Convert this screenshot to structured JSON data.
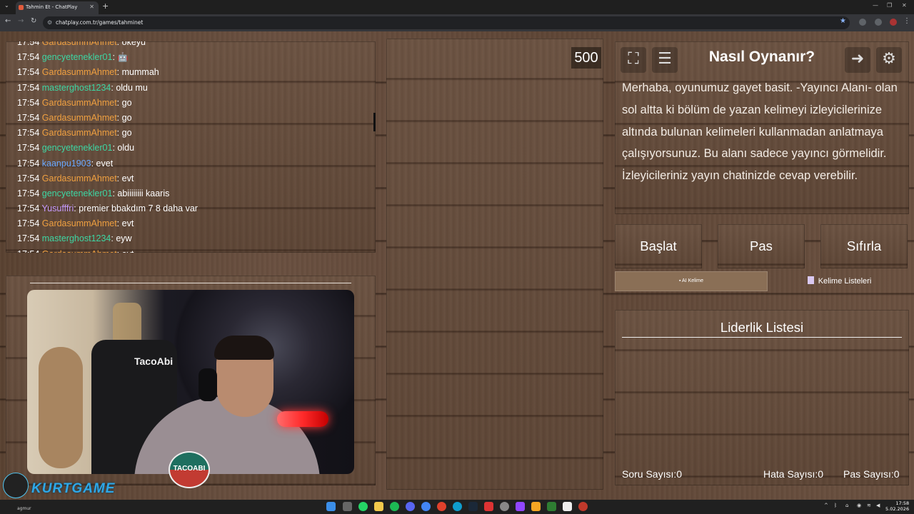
{
  "browser": {
    "tab_title": "Tahmin Et - ChatPlay",
    "new_tab": "+",
    "url": "chatplay.com.tr/games/tahminet"
  },
  "chat": {
    "messages": [
      {
        "time": "17:54",
        "user": "GardasummAhmet",
        "color": "#f0a040",
        "text": "okeyu"
      },
      {
        "time": "17:54",
        "user": "gencyetenekler01",
        "color": "#3dd6a3",
        "text": "🤖"
      },
      {
        "time": "17:54",
        "user": "GardasummAhmet",
        "color": "#f0a040",
        "text": "mummah"
      },
      {
        "time": "17:54",
        "user": "masterghost1234",
        "color": "#3dd6a3",
        "text": "oldu mu"
      },
      {
        "time": "17:54",
        "user": "GardasummAhmet",
        "color": "#f0a040",
        "text": "go"
      },
      {
        "time": "17:54",
        "user": "GardasummAhmet",
        "color": "#f0a040",
        "text": "go"
      },
      {
        "time": "17:54",
        "user": "GardasummAhmet",
        "color": "#f0a040",
        "text": "go"
      },
      {
        "time": "17:54",
        "user": "gencyetenekler01",
        "color": "#3dd6a3",
        "text": "oldu"
      },
      {
        "time": "17:54",
        "user": "kaanpu1903",
        "color": "#6aa8ff",
        "text": "evet"
      },
      {
        "time": "17:54",
        "user": "GardasummAhmet",
        "color": "#f0a040",
        "text": "evt"
      },
      {
        "time": "17:54",
        "user": "gencyetenekler01",
        "color": "#3dd6a3",
        "text": "abiiiiiiii kaaris"
      },
      {
        "time": "17:54",
        "user": "Yusufffri",
        "color": "#c79bff",
        "text": "premier bbakdım 7 8 daha var"
      },
      {
        "time": "17:54",
        "user": "GardasummAhmet",
        "color": "#f0a040",
        "text": "evt"
      },
      {
        "time": "17:54",
        "user": "masterghost1234",
        "color": "#3dd6a3",
        "text": "eyw"
      },
      {
        "time": "17:54",
        "user": "GardasummAhmet",
        "color": "#f0a040",
        "text": "evt"
      }
    ]
  },
  "webcam": {
    "chair_text": "TacoAbi",
    "badge_text": "TACOABI"
  },
  "overlay_logo": {
    "text": "KURTGAME",
    "sub": "agmur"
  },
  "game": {
    "score": "500",
    "info_title": "Nasıl Oynanır?",
    "info_text": "Merhaba, oyunumuz gayet basit. -Yayıncı Alanı- olan sol altta ki bölüm de yazan kelimeyi izleyicilerinize altında bulunan kelimeleri kullanmadan anlatmaya çalışıyorsunuz. Bu alanı sadece yayıncı görmelidir. İzleyicileriniz yayın chatinizde cevap verebilir.",
    "buttons": {
      "start": "Başlat",
      "pass": "Pas",
      "reset": "Sıfırla"
    },
    "tabs": {
      "ai_word": "AI Kelime",
      "word_lists": "Kelime Listeleri"
    },
    "leaderboard_title": "Liderlik Listesi",
    "stats": {
      "questions": "Soru Sayısı:0",
      "errors": "Hata Sayısı:0",
      "passes": "Pas Sayısı:0"
    }
  },
  "taskbar": {
    "time": "17:58",
    "date": "5.02.2026"
  }
}
